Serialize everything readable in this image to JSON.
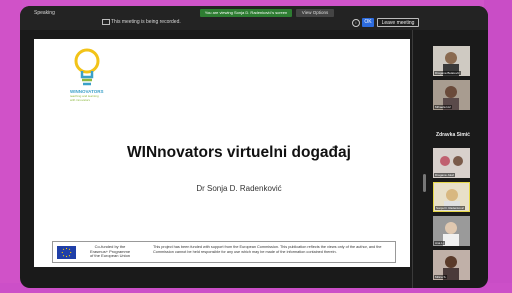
{
  "topbar": {
    "window_title": "Speaking",
    "recording_text": "This meeting is being recorded.",
    "green_banner": "You are viewing Sonja D. Radenković's screen",
    "view_options": "View Options",
    "ok_label": "OK",
    "leave_label": "Leave meeting"
  },
  "slide": {
    "brand": "WINNOVATORS",
    "brand_sub_1": "teaching and learning",
    "brand_sub_2": "with innovators",
    "title": "WINnovators virtuelni događaj",
    "subtitle": "Dr Sonja D. Radenković",
    "cofund": [
      "Co-funded by the",
      "Erasmus+ Programme",
      "of the European Union"
    ],
    "disclaimer": "This project has been funded with support from the European Commission. This publication reflects the views only of the author, and the Commission cannot be held responsible for any use which may be made of the information contained therein."
  },
  "participants": {
    "featured_name": "Zdravka Simić",
    "tiles": [
      {
        "name": "Dragana Bulatović"
      },
      {
        "name": "Mihaela Ivić"
      },
      {
        "name": "Zdravka Simić"
      },
      {
        "name": "Dragana Jokić"
      },
      {
        "name": "Sonja D. Radenković"
      },
      {
        "name": "Ana Lj."
      },
      {
        "name": "Milica S."
      }
    ]
  },
  "colors": {
    "background": "#cc55cc",
    "brand_blue": "#3aa0c8",
    "brand_green": "#8cb840",
    "ok_blue": "#2d6cdf"
  }
}
